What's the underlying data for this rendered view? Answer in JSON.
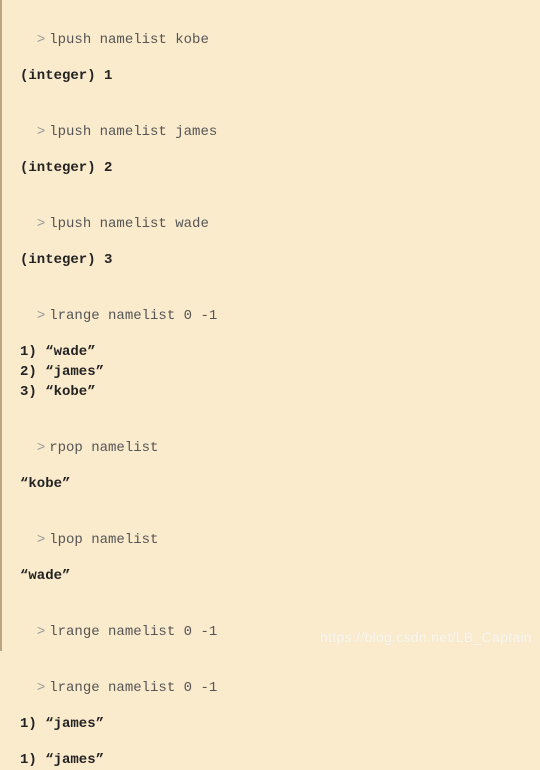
{
  "prompt": ">",
  "lines": {
    "l0": "lpush namelist kobe",
    "r0": "(integer) 1",
    "l1": "lpush namelist james",
    "r1": "(integer) 2",
    "l2": "lpush namelist wade",
    "r2": "(integer) 3",
    "l3": "lrange namelist 0 -1",
    "r3a": "1) “wade”",
    "r3b": "2) “james”",
    "r3c": "3) “kobe”",
    "l4": "rpop namelist",
    "r4": "“kobe”",
    "l5": "lpop namelist",
    "r5": "“wade”",
    "l6": "lrange namelist 0 -1",
    "l7": "lrange namelist 0 -1",
    "r7a": "1) “james”",
    "r7b": "1) “james”"
  },
  "watermark": "https://blog.csdn.net/LB_Captain"
}
